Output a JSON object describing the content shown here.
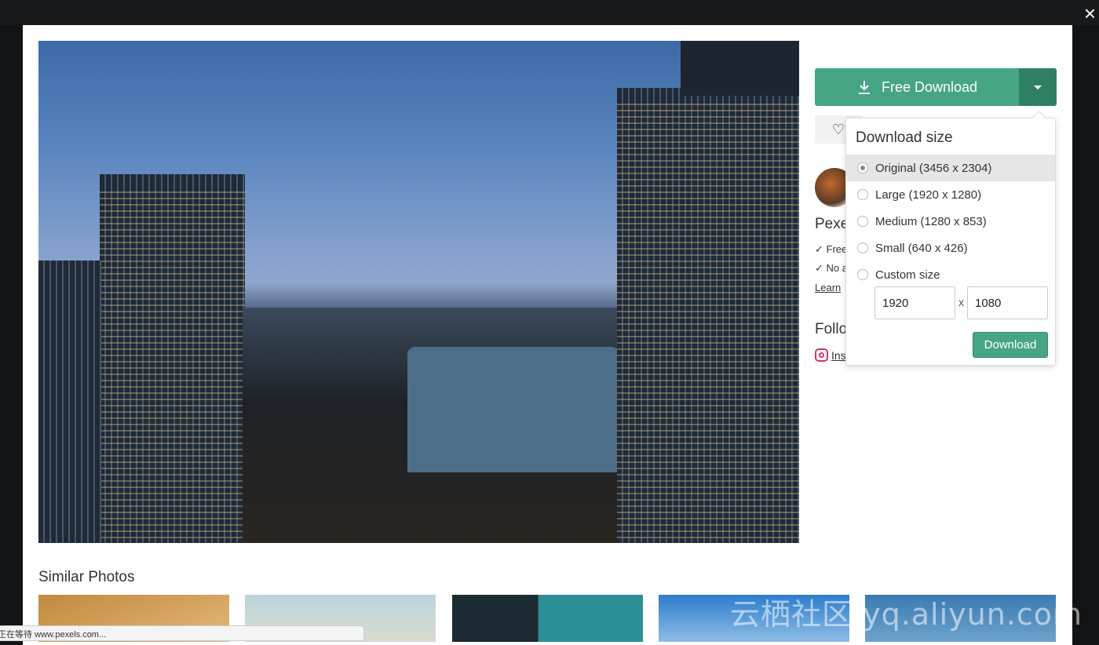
{
  "close_label": "×",
  "download": {
    "main_label": "Free Download",
    "dropdown_icon": "caret-down-icon"
  },
  "sidebar": {
    "heading_partial": "Pexe",
    "checks": [
      "✓ Free",
      "✓ No a"
    ],
    "learn_partial": "Learn",
    "follow_partial": "Follo",
    "instagram": "Instagram"
  },
  "popup": {
    "title": "Download size",
    "options": [
      {
        "label": "Original (3456 x 2304)",
        "selected": true
      },
      {
        "label": "Large (1920 x 1280)",
        "selected": false
      },
      {
        "label": "Medium (1280 x 853)",
        "selected": false
      },
      {
        "label": "Small (640 x 426)",
        "selected": false
      },
      {
        "label": "Custom size",
        "selected": false
      }
    ],
    "custom_width": "1920",
    "custom_height": "1080",
    "separator": "x",
    "button": "Download"
  },
  "similar_title": "Similar Photos",
  "status_text": "正在等待 www.pexels.com...",
  "watermark": "云栖社区 yq.aliyun.com",
  "colors": {
    "accent": "#46a583",
    "accent_dark": "#2f7f63"
  }
}
